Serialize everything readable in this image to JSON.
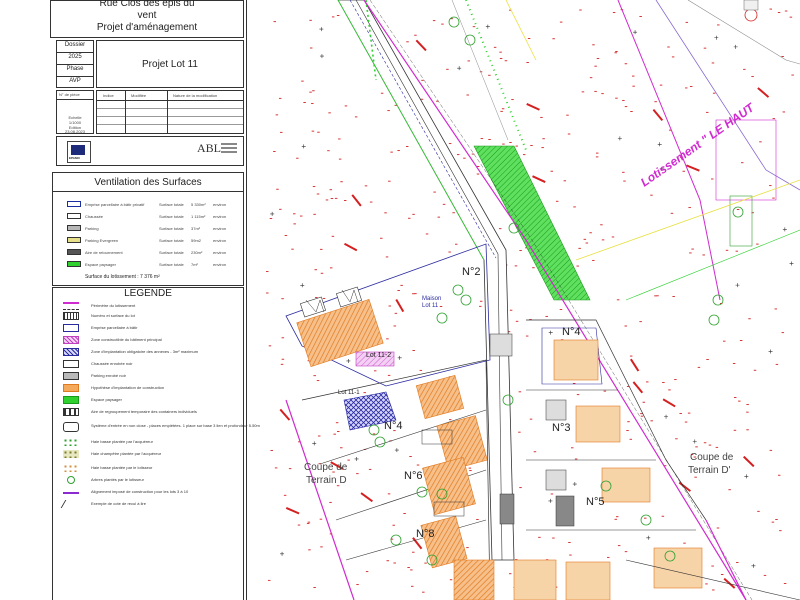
{
  "titleblock": {
    "project_line1": "Rue Clos des epis du",
    "project_line2": "vent",
    "project_line3": "Projet d'aménagement",
    "dossier_label": "Dossier",
    "dossier_value": "2025",
    "phase_label": "Phase",
    "phase_value": "AVP",
    "sheet_title": "Projet Lot 11",
    "piece_label": "N° de pièce",
    "echelle_label": "Echelle",
    "echelle_value": "1/1000",
    "edition_label": "Edition",
    "edition_value": "23.08.2023",
    "rev_headers": [
      "Indice",
      "Modifiée",
      "Nature de la modification"
    ],
    "firm_left": "EPAMO",
    "firm_right": "ABL"
  },
  "ventilation": {
    "title": "Ventilation des Surfaces",
    "rows": [
      {
        "name": "Emprise parcellaire à bâtir privatif",
        "label": "Surface totale",
        "value": "5 330m²",
        "unit": "environ",
        "color": "#ffffff",
        "border": "#1a2ea0"
      },
      {
        "name": "Chaussée",
        "label": "Surface totale",
        "value": "1 115m²",
        "unit": "environ",
        "color": "#ffffff",
        "border": "#333333"
      },
      {
        "name": "Parking",
        "label": "Surface totale",
        "value": "37m²",
        "unit": "environ",
        "color": "#b7b7b7",
        "border": "#333333"
      },
      {
        "name": "Parking Evergreen",
        "label": "Surface totale",
        "value": "59m2",
        "unit": "environ",
        "color": "#e6e08a",
        "border": "#333333"
      },
      {
        "name": "Aire de retournement",
        "label": "Surface totale",
        "value": "230m²",
        "unit": "environ",
        "color": "#555555",
        "border": "#333333"
      },
      {
        "name": "Espace paysager",
        "label": "Surface totale",
        "value": "7m²",
        "unit": "environ",
        "color": "#2fd12f",
        "border": "#333333"
      }
    ],
    "total": "Surface du lotissement : 7 376 m²"
  },
  "legend": {
    "title": "LEGENDE",
    "items": [
      {
        "text": "Périmètre du lotissement",
        "kind": "perimeter"
      },
      {
        "text": "Numéro et surface du lot",
        "kind": "lotnum"
      },
      {
        "text": "Emprise parcellaire à bâtir",
        "kind": "emprise"
      },
      {
        "text": "Zone constructible du bâtiment principal",
        "kind": "hatch"
      },
      {
        "text": "Zone d'implantation obligatoire des annexes - 3m² maximum",
        "kind": "cross"
      },
      {
        "text": "Chaussée enrobée noir",
        "kind": "chaussee"
      },
      {
        "text": "Parking enrobé noir",
        "kind": "parking"
      },
      {
        "text": "Hypothèse d'implantation de construction",
        "kind": "orange"
      },
      {
        "text": "Espace paysager",
        "kind": "green"
      },
      {
        "text": "Aire de regroupement temporaire des containers individuels",
        "kind": "containers"
      },
      {
        "text": "Système d'entrée en non close - places empiétées. 1 place sur base 3 lien et profondeur 5.50m",
        "kind": "parkspots"
      },
      {
        "text": "Haie basse plantée par l'acquéreur",
        "kind": "hedge1"
      },
      {
        "text": "Haie champêtre plantée par l'acquéreur",
        "kind": "hedge2"
      },
      {
        "text": "Haie basse plantée par le lotisseur",
        "kind": "hedge3"
      },
      {
        "text": "Arbres plantés par le lotisseur",
        "kind": "trees"
      },
      {
        "text": "Alignement imposé de construction pour les lots 3 à 10",
        "kind": "align"
      },
      {
        "text": "Exemple de cote de recul à lire",
        "kind": "cote"
      }
    ]
  },
  "plan": {
    "lots": [
      {
        "label": "N°2"
      },
      {
        "label": "N°4"
      },
      {
        "label": "N°3"
      },
      {
        "label": "N°4"
      },
      {
        "label": "N°6"
      },
      {
        "label": "N°5"
      },
      {
        "label": "N°8"
      }
    ],
    "lot_labels": {
      "lot11_2": "Lot 11-2",
      "lot11_1": "Lot 11-1",
      "maison": "Maison",
      "lot11": "Lot 11"
    },
    "coupe_left": [
      "Coupe de",
      "Terrain D"
    ],
    "coupe_right": [
      "Coupe de",
      "Terrain D'"
    ],
    "lotissement_label": "Lotissement \" LE HAUT",
    "colors": {
      "magenta": "#d02bd0",
      "red": "#d42020",
      "green": "#2fd12f",
      "hatch_orange": "#f2a060",
      "grey": "#b9b9b9"
    }
  }
}
